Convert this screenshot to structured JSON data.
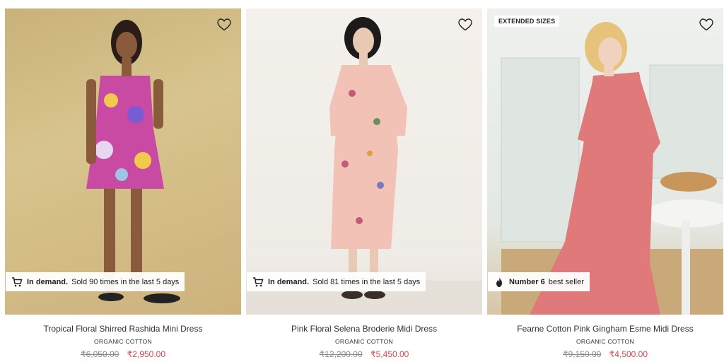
{
  "products": [
    {
      "tag": "",
      "badge_icon": "cart-icon",
      "badge_bold": "In demand.",
      "badge_text": "Sold 90 times in the last 5 days",
      "title": "Tropical Floral Shirred Rashida Mini Dress",
      "subtitle": "ORGANIC COTTON",
      "old_price": "₹6,050.00",
      "new_price": "₹2,950.00"
    },
    {
      "tag": "",
      "badge_icon": "cart-icon",
      "badge_bold": "In demand.",
      "badge_text": "Sold 81 times in the last 5 days",
      "title": "Pink Floral Selena Broderie Midi Dress",
      "subtitle": "ORGANIC COTTON",
      "old_price": "₹12,200.00",
      "new_price": "₹5,450.00"
    },
    {
      "tag": "EXTENDED SIZES",
      "badge_icon": "flame-icon",
      "badge_bold": "Number 6",
      "badge_text": "best seller",
      "title": "Fearne Cotton Pink Gingham Esme Midi Dress",
      "subtitle": "ORGANIC COTTON",
      "old_price": "₹9,150.00",
      "new_price": "₹4,500.00"
    }
  ],
  "colors": {
    "sale_price": "#d8434a",
    "old_price": "#888888"
  }
}
